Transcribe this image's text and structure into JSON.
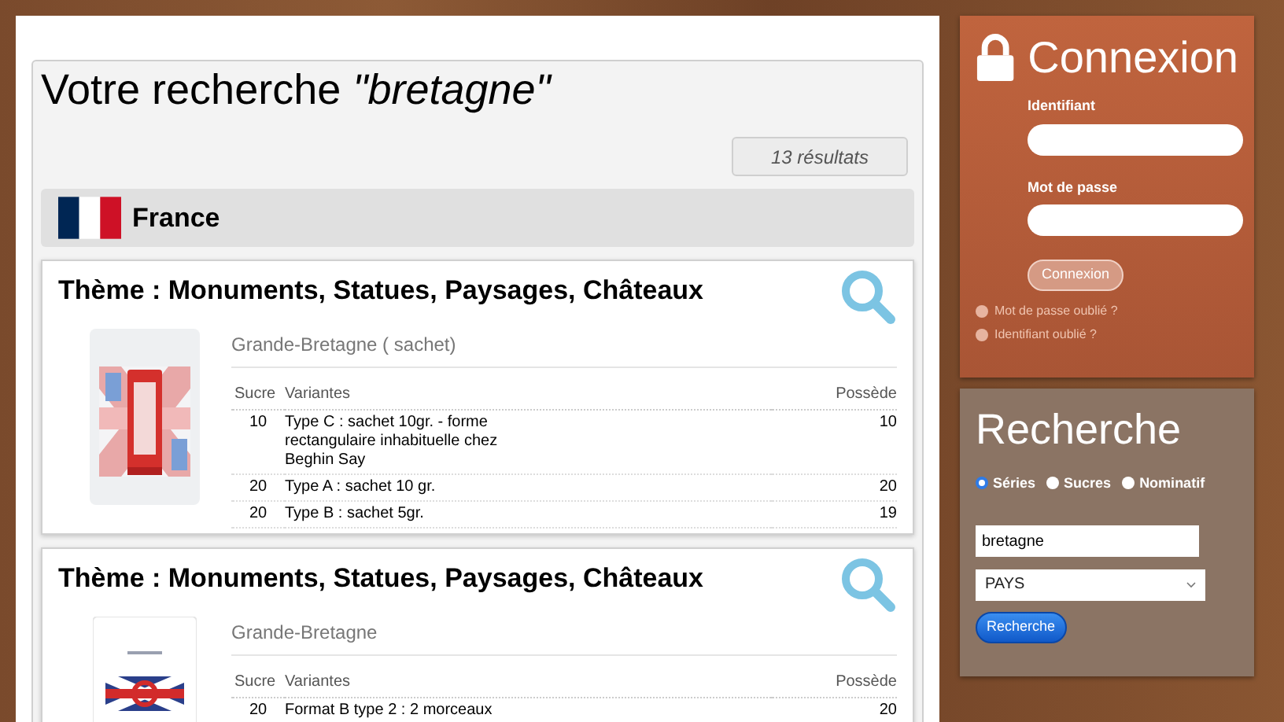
{
  "search_title": "Votre recherche *\"bretagne\"*",
  "results_count": "13 résultats",
  "country": {
    "name": "France"
  },
  "cards": [
    {
      "theme": "Thème : Monuments, Statues, Paysages, Châteaux",
      "series": "Grande-Bretagne ( sachet)",
      "image": {
        "kind": "picture"
      },
      "columns": [
        "Sucre",
        "Variantes",
        "Possède"
      ],
      "rows": [
        {
          "sucre": "10",
          "variante": "Type C : sachet 10gr. - forme rectangulaire inhabituelle chez Beghin Say",
          "possede": "10"
        },
        {
          "sucre": "20",
          "variante": "Type A : sachet 10 gr.",
          "possede": "20"
        },
        {
          "sucre": "20",
          "variante": "Type B : sachet 5gr.",
          "possede": "19"
        }
      ]
    },
    {
      "theme": "Thème : Monuments, Statues, Paysages, Châteaux",
      "series": "Grande-Bretagne",
      "image": {
        "kind": "picture"
      },
      "columns": [
        "Sucre",
        "Variantes",
        "Possède"
      ],
      "rows": [
        {
          "sucre": "20",
          "variante": "Format B type 2 : 2 morceaux",
          "possede": "20"
        }
      ]
    }
  ],
  "login": {
    "title": "Connexion",
    "username_label": "Identifiant",
    "password_label": "Mot de passe",
    "button": "Connexion",
    "links": [
      "Mot de passe oublié ?",
      "Identifiant oublié ?"
    ]
  },
  "search": {
    "title": "Recherche",
    "options": [
      {
        "label": "Séries",
        "selected": true
      },
      {
        "label": "Sucres",
        "selected": false
      },
      {
        "label": "Nominatif",
        "selected": false
      }
    ],
    "query": "bretagne",
    "select_value": "PAYS",
    "button": "Recherche"
  }
}
